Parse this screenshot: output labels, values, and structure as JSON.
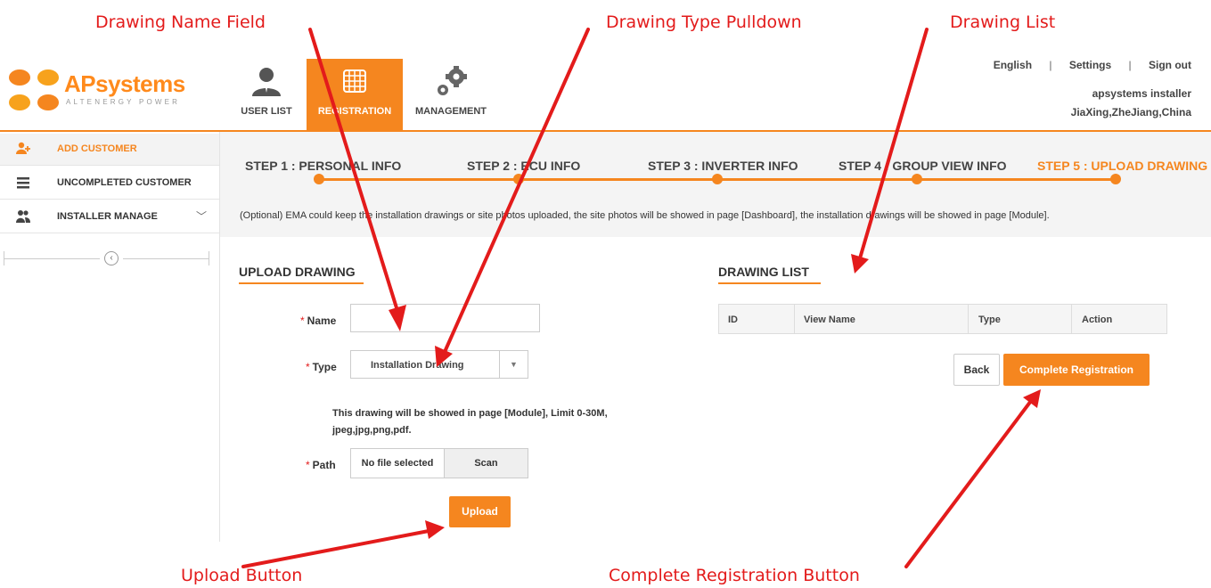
{
  "callouts": {
    "name_field": "Drawing Name Field",
    "type_pulldown": "Drawing Type Pulldown",
    "drawing_list": "Drawing List",
    "upload_button": "Upload Button",
    "complete_button": "Complete Registration Button"
  },
  "brand": {
    "name_part1": "AP",
    "name_part2": "systems",
    "tagline": "ALTENERGY POWER",
    "color": "#f5861f"
  },
  "topnav": {
    "tabs": [
      {
        "label": "USER LIST",
        "icon": "user-icon"
      },
      {
        "label": "REGISTRATION",
        "icon": "grid-icon",
        "active": true
      },
      {
        "label": "MANAGEMENT",
        "icon": "gears-icon"
      }
    ],
    "links": {
      "language": "English",
      "settings": "Settings",
      "signout": "Sign out",
      "separator": "|"
    },
    "user": {
      "name": "apsystems installer",
      "location": "JiaXing,ZheJiang,China"
    }
  },
  "sidebar": {
    "items": [
      {
        "label": "ADD CUSTOMER",
        "icon": "add-user-icon",
        "active": true
      },
      {
        "label": "UNCOMPLETED CUSTOMER",
        "icon": "list-icon"
      },
      {
        "label": "INSTALLER MANAGE",
        "icon": "users-icon",
        "chevron": "﹀"
      }
    ],
    "collapse_glyph": "‹"
  },
  "steps": {
    "items": [
      {
        "label": "STEP 1 : PERSONAL INFO"
      },
      {
        "label": "STEP 2 : ECU INFO"
      },
      {
        "label": "STEP 3 : INVERTER INFO"
      },
      {
        "label": "STEP 4 : GROUP VIEW INFO"
      },
      {
        "label": "STEP 5 : UPLOAD DRAWING",
        "active": true
      }
    ],
    "note": "(Optional) EMA could keep the installation drawings or site photos uploaded, the site photos will be showed in page [Dashboard], the installation drawings will be showed in page [Module]."
  },
  "upload": {
    "title": "UPLOAD DRAWING",
    "required_mark": "*",
    "name_label": "Name",
    "name_value": "",
    "type_label": "Type",
    "type_value": "Installation Drawing",
    "type_caret": "▼",
    "hint_line1": "This drawing will be showed in page [Module], Limit 0-30M,",
    "hint_line2": "jpeg,jpg,png,pdf.",
    "path_label": "Path",
    "file_value": "No file selected",
    "scan_label": "Scan",
    "upload_label": "Upload"
  },
  "drawing_list": {
    "title": "DRAWING LIST",
    "columns": [
      "ID",
      "View Name",
      "Type",
      "Action"
    ]
  },
  "actions": {
    "back": "Back",
    "complete": "Complete Registration"
  }
}
